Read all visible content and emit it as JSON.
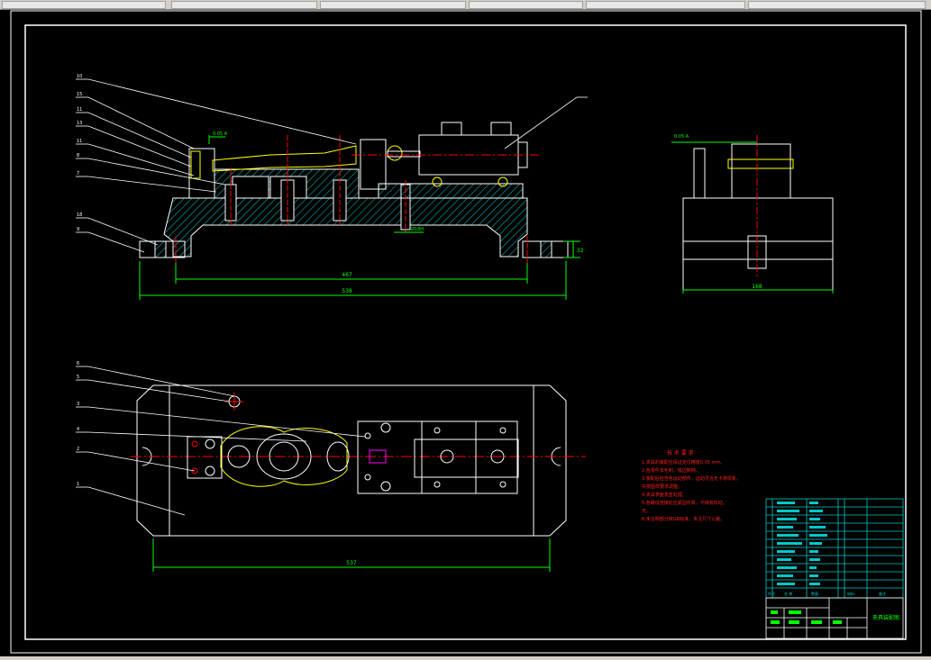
{
  "window": {
    "title": ""
  },
  "toolbar": {
    "tabs": [
      "",
      "",
      "",
      "",
      "",
      ""
    ]
  },
  "front_view": {
    "balloons": [
      "10",
      "15",
      "11",
      "13",
      "11",
      "8",
      "7",
      "18",
      "9"
    ],
    "dim_inner": "467",
    "dim_overall": "538",
    "dim_height": "32",
    "note_top": "0.05 A",
    "note_bottom": "Ø18H"
  },
  "side_view": {
    "dim_width": "168",
    "note_top": "0.05 A"
  },
  "top_view": {
    "balloons": [
      "6",
      "5",
      "3",
      "4",
      "2",
      "1"
    ],
    "dim_overall": "537"
  },
  "tech_requirements": {
    "title": "技 术 要 求",
    "lines": [
      "1.夹具的装配应保证定位精度0.05 mm。",
      "2.各零件去毛刺，锐边倒钝。",
      "3.装配后检查各运动部件，运动灵活无卡滞现象，",
      "并按图样要求调整。",
      "4.夹具表面发蓝处理。",
      "5.各螺纹连接处应紧固可靠，不得有松动，",
      "无。",
      "6.未注明部分按GB标准，未注尺寸公差。"
    ]
  },
  "title_block": {
    "drawing_name": "夹具装配图",
    "header_labels": [
      "序号",
      "名 称",
      "数量",
      "材料",
      "备注"
    ]
  },
  "colors": {
    "frame": "#ffffff",
    "part": "#ffff00",
    "hatch": "#00ffff",
    "center": "#ff0000",
    "dim": "#00ff00",
    "table": "#00ffff"
  }
}
